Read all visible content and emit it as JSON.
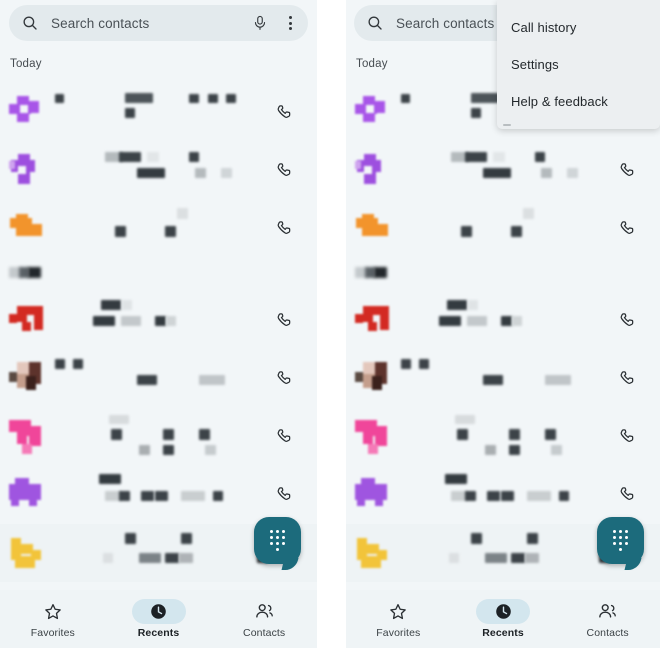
{
  "app": {
    "screen_name": "Phone app - Recents",
    "panel_bg": "#f2f6f8",
    "accent_teal": "#1c6b7c",
    "nav_pill": "#d3e6ee"
  },
  "search": {
    "placeholder": "Search contacts",
    "search_icon": "search-icon",
    "mic_icon": "microphone-icon",
    "overflow_icon": "more-vert-icon"
  },
  "section": {
    "today_label": "Today"
  },
  "menu": {
    "items": [
      {
        "label": "Call history"
      },
      {
        "label": "Settings"
      },
      {
        "label": "Help & feedback"
      }
    ]
  },
  "fab": {
    "icon": "dialpad-icon",
    "color": "#1c6b7c"
  },
  "bottom_nav": {
    "items": [
      {
        "label": "Favorites",
        "icon": "star-outline-icon",
        "selected": false
      },
      {
        "label": "Recents",
        "icon": "clock-filled-icon",
        "selected": true
      },
      {
        "label": "Contacts",
        "icon": "people-icon",
        "selected": false
      }
    ]
  },
  "call_list": {
    "call_action_icon": "phone-handset-icon",
    "rows": [
      {
        "avatar_color": "#a855e8",
        "avatar_type": "monogram",
        "redacted": true,
        "action": "call"
      },
      {
        "avatar_color": "#9d4fdf",
        "avatar_type": "monogram",
        "redacted": true,
        "action": "call"
      },
      {
        "avatar_color": "#f2942c",
        "avatar_type": "monogram",
        "redacted": true,
        "action": "call"
      },
      {
        "avatar_color": "#d32a22",
        "avatar_type": "monogram",
        "redacted": true,
        "action": "call"
      },
      {
        "avatar_color": "#6b4a44",
        "avatar_type": "photo",
        "redacted": true,
        "action": "call"
      },
      {
        "avatar_color": "#f0469a",
        "avatar_type": "monogram",
        "redacted": true,
        "action": "call"
      },
      {
        "avatar_color": "#9f55e0",
        "avatar_type": "monogram",
        "redacted": true,
        "action": "call"
      },
      {
        "avatar_color": "#f2c43a",
        "avatar_type": "monogram",
        "redacted": true,
        "action": "call",
        "highlighted": true
      }
    ],
    "divider_strip": {
      "redacted": true
    }
  }
}
